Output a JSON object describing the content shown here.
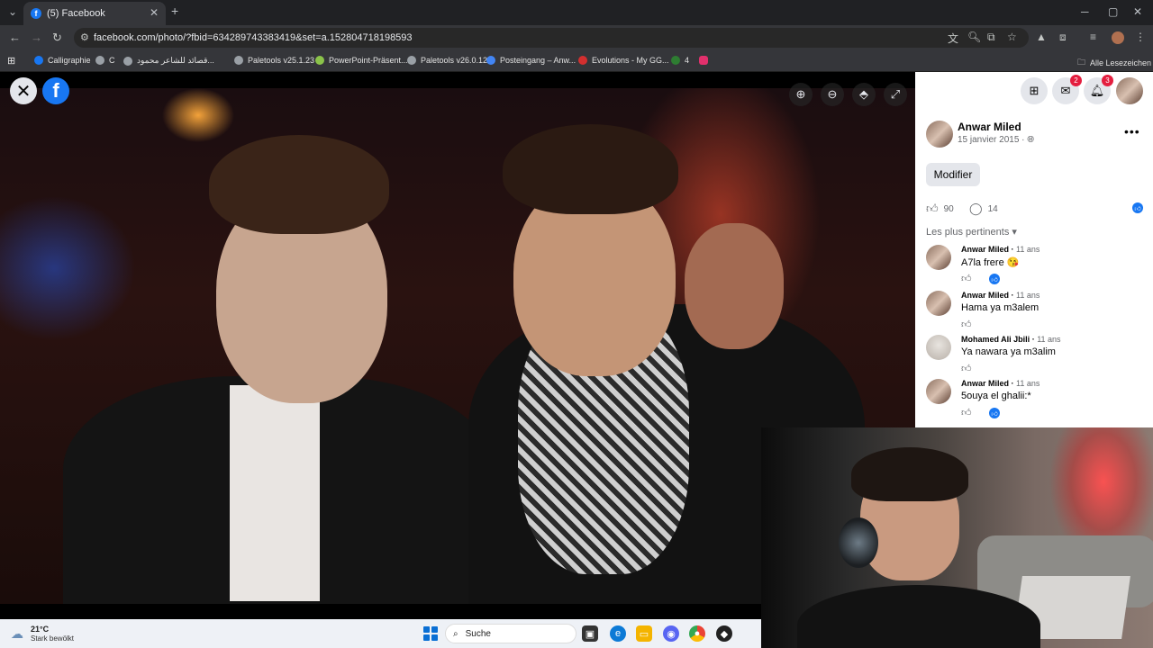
{
  "browser": {
    "tab_title": "(5) Facebook",
    "tab_favicon_letter": "f",
    "new_tab": "+",
    "url_host": "facebook.com",
    "url_path": "/photo/?fbid=634289743383419&set=a.152804718198593"
  },
  "bookmarks": [
    {
      "label": "Calligraphie",
      "color": "#1877f2"
    },
    {
      "label": "C",
      "color": "#9aa0a6"
    },
    {
      "label": "قصائد للشاعر محمود...",
      "color": "#9aa0a6"
    },
    {
      "label": "Paletools v25.1.23",
      "color": "#9aa0a6"
    },
    {
      "label": "PowerPoint-Präsent...",
      "color": "#8bc34a"
    },
    {
      "label": "Paletools v26.0.12",
      "color": "#9aa0a6"
    },
    {
      "label": "Posteingang – Anw...",
      "color": "#4285f4"
    },
    {
      "label": "Evolutions - My GG...",
      "color": "#d32f2f"
    },
    {
      "label": "4",
      "color": "#2e7d32"
    },
    {
      "label": "",
      "color": "#e1306c"
    }
  ],
  "bookmarks_all": "Alle Lesezeichen",
  "viewer": {
    "close_symbol": "✕",
    "logo_letter": "f"
  },
  "header": {
    "messenger_badge": "2",
    "notifications_badge": "3"
  },
  "post": {
    "author": "Anwar Miled",
    "date": "15 janvier 2015",
    "more": "•••",
    "edit_button": "Modifier",
    "likes": "90",
    "comments_count": "14",
    "sort_label": "Les plus pertinents"
  },
  "comments": [
    {
      "author": "Anwar Miled",
      "time": "11 ans",
      "text": "A7la frere 😘",
      "reacted": true
    },
    {
      "author": "Anwar Miled",
      "time": "11 ans",
      "text": "Hama ya m3alem",
      "reacted": false
    },
    {
      "author": "Mohamed Ali Jbili",
      "time": "11 ans",
      "text": "Ya nawara ya m3alim",
      "reacted": false
    },
    {
      "author": "Anwar Miled",
      "time": "11 ans",
      "text": "5ouya el ghalii:*",
      "reacted": true
    }
  ],
  "taskbar": {
    "temperature": "21°C",
    "weather": "Stark bewölkt",
    "search_placeholder": "Suche"
  }
}
